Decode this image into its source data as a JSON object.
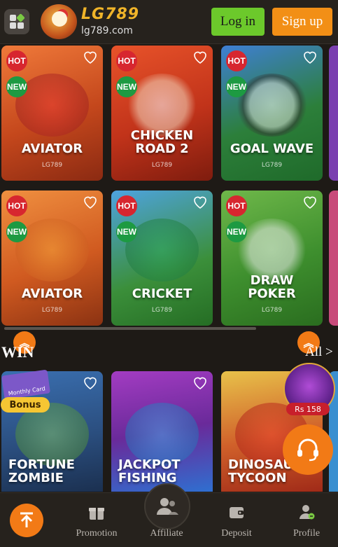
{
  "header": {
    "brand": "LG789",
    "domain": "lg789.com",
    "login_label": "Log in",
    "signup_label": "Sign up"
  },
  "games_row1": [
    {
      "title": "AVIATOR",
      "provider": "LG789",
      "hot": "HOT",
      "new": "NEW"
    },
    {
      "title": "CHICKEN\nROAD 2",
      "provider": "LG789",
      "hot": "HOT",
      "new": "NEW"
    },
    {
      "title": "GOAL WAVE",
      "provider": "LG789",
      "hot": "HOT",
      "new": "NEW"
    }
  ],
  "games_row2": [
    {
      "title": "AVIATOR",
      "provider": "LG789",
      "hot": "HOT",
      "new": "NEW"
    },
    {
      "title": "CRICKET",
      "provider": "LG789",
      "hot": "HOT",
      "new": "NEW"
    },
    {
      "title": "DRAW\nPOKER",
      "provider": "LG789",
      "hot": "HOT",
      "new": "NEW"
    }
  ],
  "section": {
    "title": "WIN",
    "all_label": "All >"
  },
  "games_row3": [
    {
      "title": "FORTUNE\nZOMBIE"
    },
    {
      "title": "JACKPOT\nFISHING"
    },
    {
      "title": "DINOSAUR\nTYCOON"
    }
  ],
  "promo": {
    "bonus_label": "Bonus",
    "monthly_card_label": "Monthly Card",
    "chest_amount": "Rs 158"
  },
  "bottom_nav": {
    "promotion": "Promotion",
    "affiliate": "Affiliate",
    "deposit": "Deposit",
    "profile": "Profile"
  },
  "colors": {
    "accent_orange": "#f27a16",
    "login_green": "#6cc92b",
    "hot_red": "#d7262f",
    "new_green": "#1d9a42"
  }
}
